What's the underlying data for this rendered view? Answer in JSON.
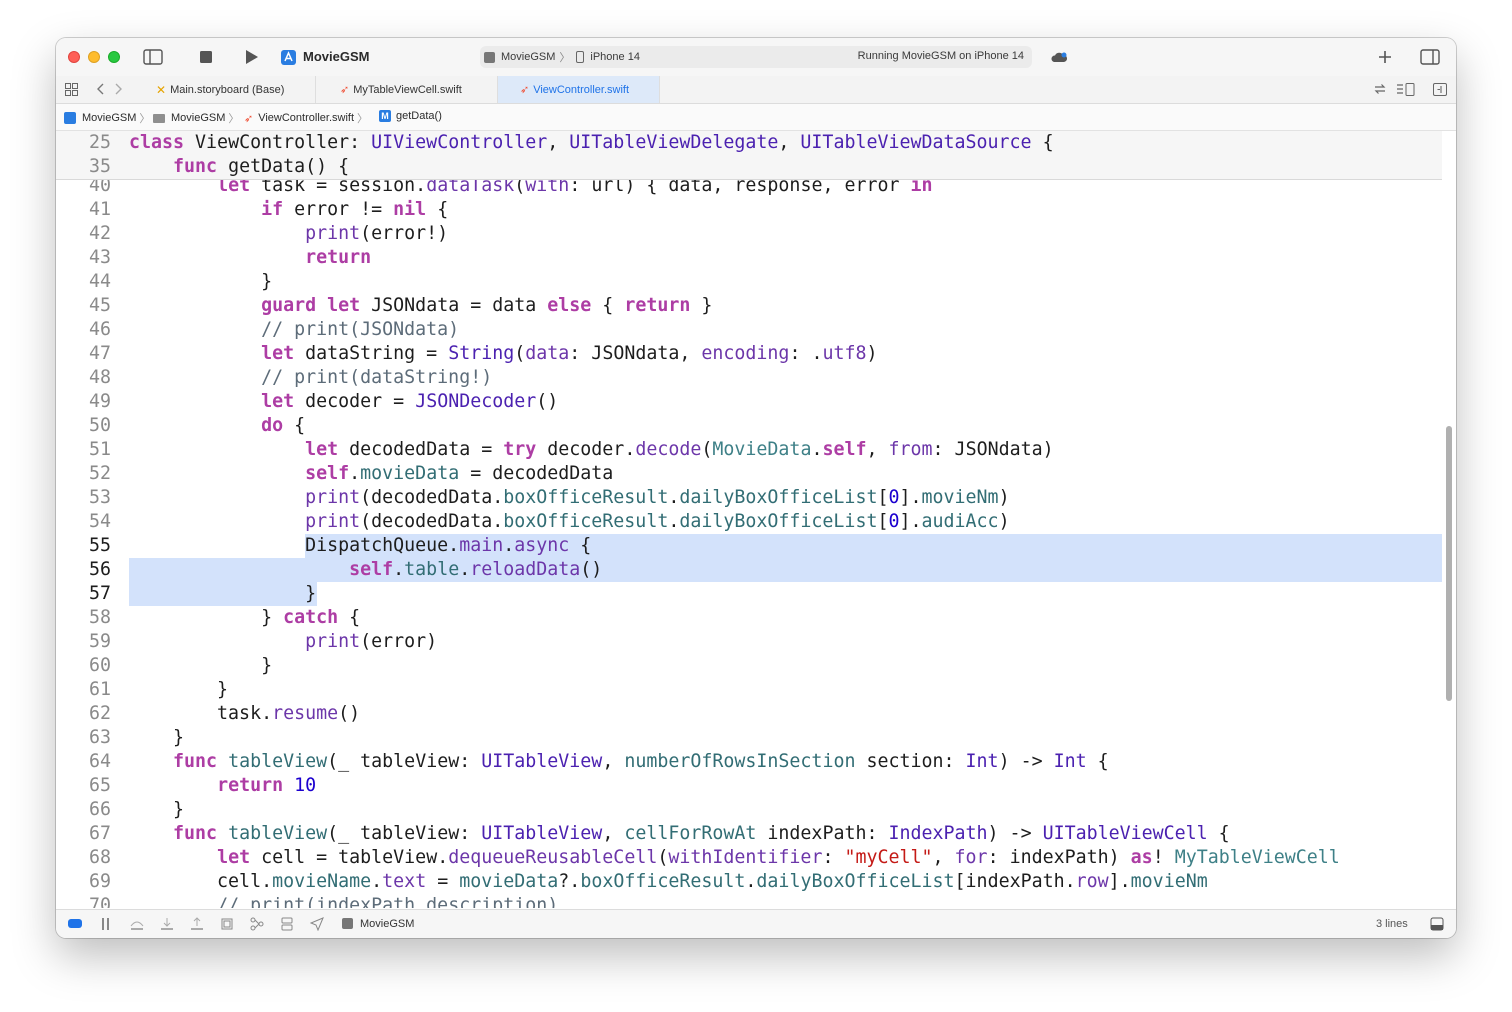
{
  "toolbar": {
    "project_title": "MovieGSM",
    "scheme_name": "MovieGSM",
    "device_name": "iPhone 14",
    "status_text": "Running MovieGSM on iPhone 14"
  },
  "tabs": [
    {
      "label": "Main.storyboard (Base)"
    },
    {
      "label": "MyTableViewCell.swift"
    },
    {
      "label": "ViewController.swift"
    }
  ],
  "jumpbar": [
    "MovieGSM",
    "MovieGSM",
    "ViewController.swift",
    "getData()"
  ],
  "sticky_lines": [
    {
      "num": "25",
      "tokens": [
        [
          "k",
          "class"
        ],
        [
          "p",
          " "
        ],
        [
          "p",
          "ViewController"
        ],
        [
          "p",
          ": "
        ],
        [
          "ty",
          "UIViewController"
        ],
        [
          "p",
          ", "
        ],
        [
          "ty",
          "UITableViewDelegate"
        ],
        [
          "p",
          ", "
        ],
        [
          "ty",
          "UITableViewDataSource"
        ],
        [
          "p",
          " {"
        ]
      ]
    },
    {
      "num": "35",
      "tokens": [
        [
          "p",
          "    "
        ],
        [
          "k",
          "func"
        ],
        [
          "p",
          " "
        ],
        [
          "p",
          "getData"
        ],
        [
          "p",
          "() {"
        ]
      ]
    }
  ],
  "code_lines": [
    {
      "num": "40",
      "tokens": [
        [
          "p",
          "        "
        ],
        [
          "k",
          "let"
        ],
        [
          "p",
          " task = session."
        ],
        [
          "f",
          "dataTask"
        ],
        [
          "p",
          "("
        ],
        [
          "f",
          "with"
        ],
        [
          "p",
          ": url) { data, response, error "
        ],
        [
          "k",
          "in"
        ]
      ]
    },
    {
      "num": "41",
      "tokens": [
        [
          "p",
          "            "
        ],
        [
          "k",
          "if"
        ],
        [
          "p",
          " error != "
        ],
        [
          "k",
          "nil"
        ],
        [
          "p",
          " {"
        ]
      ]
    },
    {
      "num": "42",
      "tokens": [
        [
          "p",
          "                "
        ],
        [
          "f",
          "print"
        ],
        [
          "p",
          "(error!)"
        ]
      ]
    },
    {
      "num": "43",
      "tokens": [
        [
          "p",
          "                "
        ],
        [
          "k",
          "return"
        ]
      ]
    },
    {
      "num": "44",
      "tokens": [
        [
          "p",
          "            }"
        ]
      ]
    },
    {
      "num": "45",
      "tokens": [
        [
          "p",
          "            "
        ],
        [
          "k",
          "guard"
        ],
        [
          "p",
          " "
        ],
        [
          "k",
          "let"
        ],
        [
          "p",
          " JSONdata = data "
        ],
        [
          "k",
          "else"
        ],
        [
          "p",
          " { "
        ],
        [
          "k",
          "return"
        ],
        [
          "p",
          " }"
        ]
      ]
    },
    {
      "num": "46",
      "tokens": [
        [
          "p",
          "            "
        ],
        [
          "c",
          "// print(JSONdata)"
        ]
      ]
    },
    {
      "num": "47",
      "tokens": [
        [
          "p",
          "            "
        ],
        [
          "k",
          "let"
        ],
        [
          "p",
          " dataString = "
        ],
        [
          "ty",
          "String"
        ],
        [
          "p",
          "("
        ],
        [
          "f",
          "data"
        ],
        [
          "p",
          ": JSONdata, "
        ],
        [
          "f",
          "encoding"
        ],
        [
          "p",
          ": ."
        ],
        [
          "f",
          "utf8"
        ],
        [
          "p",
          ")"
        ]
      ]
    },
    {
      "num": "48",
      "tokens": [
        [
          "p",
          "            "
        ],
        [
          "c",
          "// print(dataString!)"
        ]
      ]
    },
    {
      "num": "49",
      "tokens": [
        [
          "p",
          "            "
        ],
        [
          "k",
          "let"
        ],
        [
          "p",
          " decoder = "
        ],
        [
          "ty",
          "JSONDecoder"
        ],
        [
          "p",
          "()"
        ]
      ]
    },
    {
      "num": "50",
      "tokens": [
        [
          "p",
          "            "
        ],
        [
          "k",
          "do"
        ],
        [
          "p",
          " {"
        ]
      ]
    },
    {
      "num": "51",
      "tokens": [
        [
          "p",
          "                "
        ],
        [
          "k",
          "let"
        ],
        [
          "p",
          " decodedData = "
        ],
        [
          "k",
          "try"
        ],
        [
          "p",
          " decoder."
        ],
        [
          "f",
          "decode"
        ],
        [
          "p",
          "("
        ],
        [
          "pt",
          "MovieData"
        ],
        [
          "p",
          "."
        ],
        [
          "k",
          "self"
        ],
        [
          "p",
          ", "
        ],
        [
          "f",
          "from"
        ],
        [
          "p",
          ": JSONdata)"
        ]
      ]
    },
    {
      "num": "52",
      "tokens": [
        [
          "p",
          "                "
        ],
        [
          "k",
          "self"
        ],
        [
          "p",
          "."
        ],
        [
          "tl",
          "movieData"
        ],
        [
          "p",
          " = decodedData"
        ]
      ]
    },
    {
      "num": "53",
      "tokens": [
        [
          "p",
          "                "
        ],
        [
          "f",
          "print"
        ],
        [
          "p",
          "(decodedData."
        ],
        [
          "tl",
          "boxOfficeResult"
        ],
        [
          "p",
          "."
        ],
        [
          "tl",
          "dailyBoxOfficeList"
        ],
        [
          "p",
          "["
        ],
        [
          "n",
          "0"
        ],
        [
          "p",
          "]."
        ],
        [
          "tl",
          "movieNm"
        ],
        [
          "p",
          ")"
        ]
      ]
    },
    {
      "num": "54",
      "tokens": [
        [
          "p",
          "                "
        ],
        [
          "f",
          "print"
        ],
        [
          "p",
          "(decodedData."
        ],
        [
          "tl",
          "boxOfficeResult"
        ],
        [
          "p",
          "."
        ],
        [
          "tl",
          "dailyBoxOfficeList"
        ],
        [
          "p",
          "["
        ],
        [
          "n",
          "0"
        ],
        [
          "p",
          "]."
        ],
        [
          "tl",
          "audiAcc"
        ],
        [
          "p",
          ")"
        ]
      ]
    },
    {
      "num": "55",
      "tokens": [
        [
          "p",
          "                DispatchQueue."
        ],
        [
          "f",
          "main"
        ],
        [
          "p",
          "."
        ],
        [
          "f",
          "async"
        ],
        [
          "p",
          " {"
        ]
      ]
    },
    {
      "num": "56",
      "tokens": [
        [
          "p",
          "                    "
        ],
        [
          "k",
          "self"
        ],
        [
          "p",
          "."
        ],
        [
          "tl",
          "table"
        ],
        [
          "p",
          "."
        ],
        [
          "f",
          "reloadData"
        ],
        [
          "p",
          "()"
        ]
      ]
    },
    {
      "num": "57",
      "tokens": [
        [
          "p",
          "                }"
        ]
      ]
    },
    {
      "num": "58",
      "tokens": [
        [
          "p",
          "            } "
        ],
        [
          "k",
          "catch"
        ],
        [
          "p",
          " {"
        ]
      ]
    },
    {
      "num": "59",
      "tokens": [
        [
          "p",
          "                "
        ],
        [
          "f",
          "print"
        ],
        [
          "p",
          "(error)"
        ]
      ]
    },
    {
      "num": "60",
      "tokens": [
        [
          "p",
          "            }"
        ]
      ]
    },
    {
      "num": "61",
      "tokens": [
        [
          "p",
          "        }"
        ]
      ]
    },
    {
      "num": "62",
      "tokens": [
        [
          "p",
          "        task."
        ],
        [
          "f",
          "resume"
        ],
        [
          "p",
          "()"
        ]
      ]
    },
    {
      "num": "63",
      "tokens": [
        [
          "p",
          "    }"
        ]
      ]
    },
    {
      "num": "64",
      "tokens": [
        [
          "p",
          "    "
        ],
        [
          "k",
          "func"
        ],
        [
          "p",
          " "
        ],
        [
          "tl",
          "tableView"
        ],
        [
          "p",
          "(_ tableView: "
        ],
        [
          "ty",
          "UITableView"
        ],
        [
          "p",
          ", "
        ],
        [
          "tl",
          "numberOfRowsInSection"
        ],
        [
          "p",
          " section: "
        ],
        [
          "ty",
          "Int"
        ],
        [
          "p",
          ") -> "
        ],
        [
          "ty",
          "Int"
        ],
        [
          "p",
          " {"
        ]
      ]
    },
    {
      "num": "65",
      "tokens": [
        [
          "p",
          "        "
        ],
        [
          "k",
          "return"
        ],
        [
          "p",
          " "
        ],
        [
          "n",
          "10"
        ]
      ]
    },
    {
      "num": "66",
      "tokens": [
        [
          "p",
          "    }"
        ]
      ]
    },
    {
      "num": "67",
      "tokens": [
        [
          "p",
          "    "
        ],
        [
          "k",
          "func"
        ],
        [
          "p",
          " "
        ],
        [
          "tl",
          "tableView"
        ],
        [
          "p",
          "(_ tableView: "
        ],
        [
          "ty",
          "UITableView"
        ],
        [
          "p",
          ", "
        ],
        [
          "tl",
          "cellForRowAt"
        ],
        [
          "p",
          " indexPath: "
        ],
        [
          "ty",
          "IndexPath"
        ],
        [
          "p",
          ") -> "
        ],
        [
          "ty",
          "UITableViewCell"
        ],
        [
          "p",
          " {"
        ]
      ]
    },
    {
      "num": "68",
      "tokens": [
        [
          "p",
          "        "
        ],
        [
          "k",
          "let"
        ],
        [
          "p",
          " cell = tableView."
        ],
        [
          "f",
          "dequeueReusableCell"
        ],
        [
          "p",
          "("
        ],
        [
          "f",
          "withIdentifier"
        ],
        [
          "p",
          ": "
        ],
        [
          "s",
          "\"myCell\""
        ],
        [
          "p",
          ", "
        ],
        [
          "f",
          "for"
        ],
        [
          "p",
          ": indexPath) "
        ],
        [
          "k",
          "as"
        ],
        [
          "p",
          "! "
        ],
        [
          "pt",
          "MyTableViewCell"
        ]
      ]
    },
    {
      "num": "69",
      "tokens": [
        [
          "p",
          "        cell."
        ],
        [
          "tl",
          "movieName"
        ],
        [
          "p",
          "."
        ],
        [
          "f",
          "text"
        ],
        [
          "p",
          " = "
        ],
        [
          "tl",
          "movieData"
        ],
        [
          "p",
          "?."
        ],
        [
          "tl",
          "boxOfficeResult"
        ],
        [
          "p",
          "."
        ],
        [
          "tl",
          "dailyBoxOfficeList"
        ],
        [
          "p",
          "[indexPath."
        ],
        [
          "f",
          "row"
        ],
        [
          "p",
          "]."
        ],
        [
          "tl",
          "movieNm"
        ]
      ]
    },
    {
      "num": "70",
      "tokens": [
        [
          "p",
          "        "
        ],
        [
          "c",
          "// print(indexPath.description)"
        ]
      ]
    }
  ],
  "selection": {
    "start_line": "55",
    "end_line": "57"
  },
  "bottombar": {
    "target_label": "MovieGSM",
    "selection_info": "3 lines"
  },
  "colors": {
    "keyword": "#ad3da4",
    "type": "#4b21b0",
    "project_type": "#3e8087",
    "function": "#6c36a9",
    "property": "#326d74",
    "comment": "#5d6c79",
    "string": "#c41a16",
    "number": "#1c00cf",
    "selection": "#d3e2fb",
    "accent": "#1f73e8"
  },
  "icons": [
    "sidebar-icon",
    "stop-icon",
    "run-icon",
    "app-icon",
    "plus-icon",
    "inspector-icon",
    "grid-icon",
    "back-icon",
    "forward-icon",
    "interface-builder-icon",
    "swift-icon",
    "refresh-icon",
    "editor-options-icon",
    "add-editor-icon",
    "folder-icon",
    "method-icon",
    "breakpoint-icon",
    "pause-icon",
    "step-over-icon",
    "step-in-icon",
    "step-out-icon",
    "debug-view-icon",
    "memory-icon",
    "environment-icon",
    "location-icon",
    "console-toggle-icon"
  ]
}
